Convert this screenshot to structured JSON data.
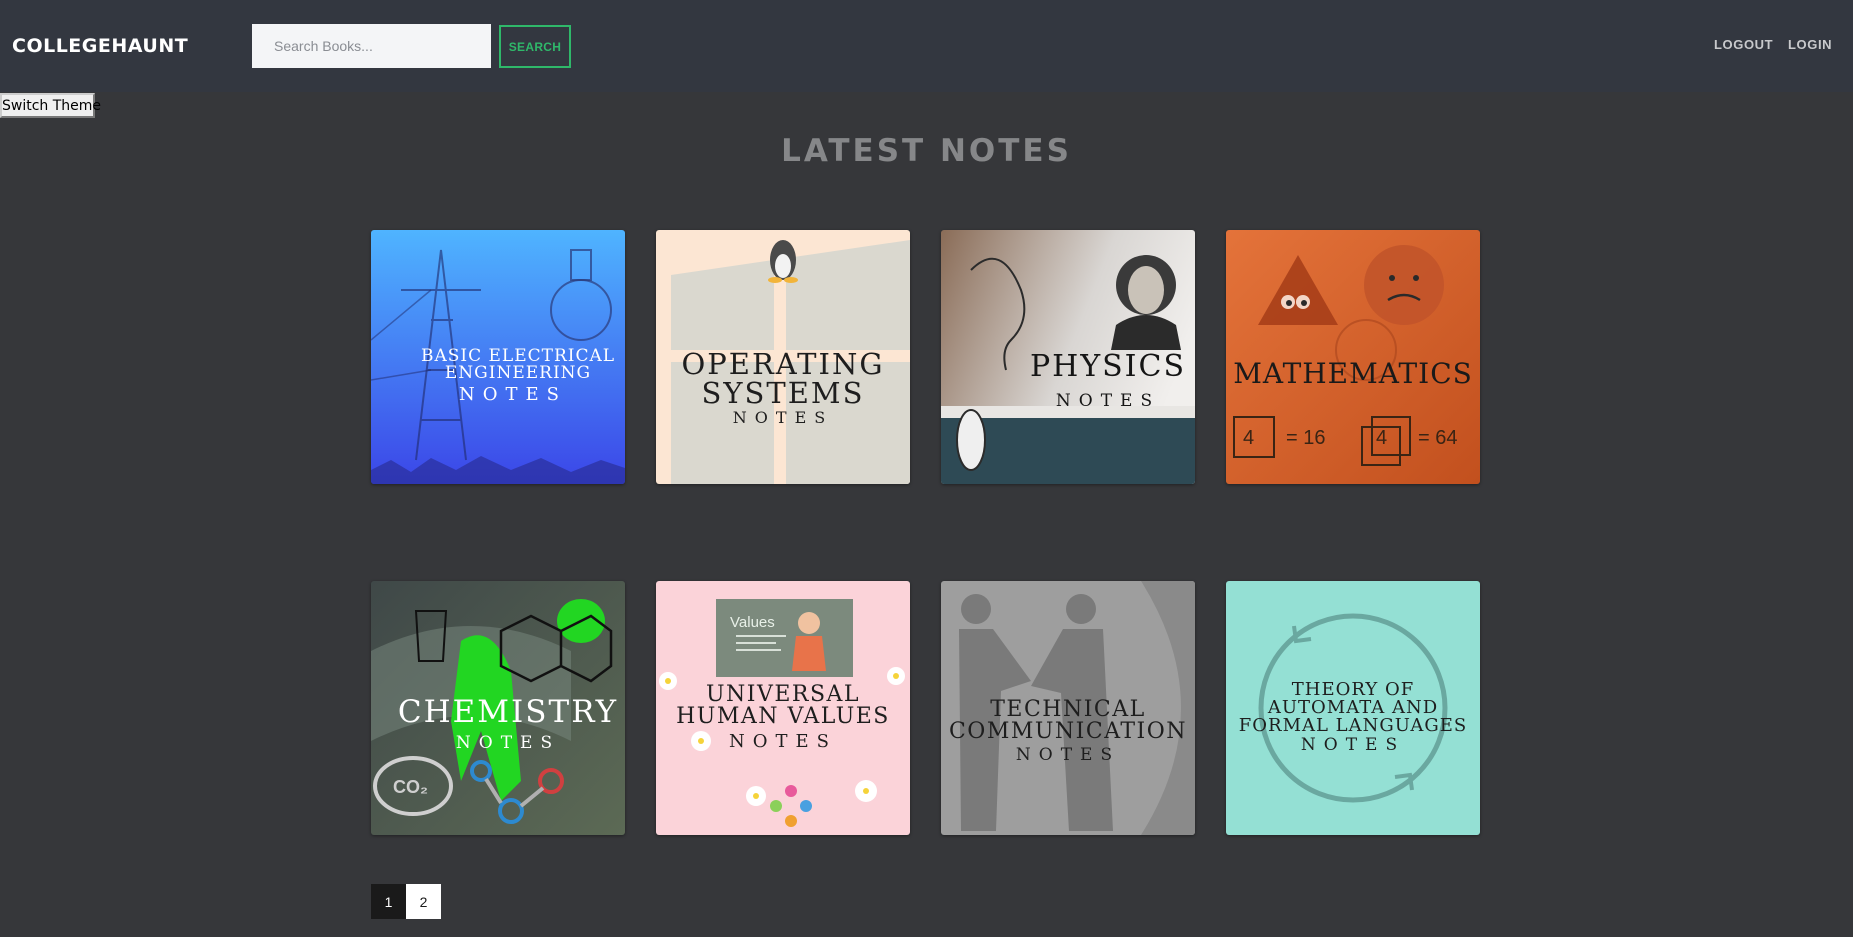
{
  "brand": "COLLEGEHAUNT",
  "search": {
    "placeholder": "Search Books...",
    "value": "",
    "button_label": "SEARCH"
  },
  "nav": {
    "logout_label": "LOGOUT",
    "login_label": "LOGIN"
  },
  "switch_theme_label": "Switch Theme",
  "section_title": "LATEST NOTES",
  "notes": [
    {
      "title": "BASIC ELECTRICAL ENGINEERING",
      "subtitle": "NOTES",
      "colors": [
        "#4fb4ff",
        "#3b46e8"
      ],
      "icon": "lightbulb-icon"
    },
    {
      "title": "OPERATING SYSTEMS",
      "subtitle": "NOTES",
      "colors": [
        "#fce6d3",
        "#dad8cf"
      ],
      "icon": "penguin-icon"
    },
    {
      "title": "PHYSICS",
      "subtitle": "NOTES",
      "colors": [
        "#8a6c57",
        "#2e4a55"
      ],
      "icon": "apple-icon"
    },
    {
      "title": "MATHEMATICS",
      "subtitle": "",
      "colors": [
        "#e4733a",
        "#c2501e"
      ],
      "icon": "triangle-icon",
      "equations": [
        "4",
        "= 16",
        "4",
        "= 64"
      ]
    },
    {
      "title": "CHEMISTRY",
      "subtitle": "NOTES",
      "colors": [
        "#3f4848",
        "#5c6a55"
      ],
      "icon": "molecule-icon",
      "badge": "CO₂"
    },
    {
      "title": "UNIVERSAL HUMAN VALUES",
      "subtitle": "NOTES",
      "colors": [
        "#fbd3d9",
        "#f6bcc6"
      ],
      "icon": "flower-icon",
      "board_text": "Values"
    },
    {
      "title": "TECHNICAL COMMUNICATION",
      "subtitle": "NOTES",
      "colors": [
        "#9e9e9e",
        "#8a8a8a"
      ],
      "icon": "handshake-icon"
    },
    {
      "title": "THEORY OF AUTOMATA AND FORMAL LANGUAGES",
      "subtitle": "NOTES",
      "colors": [
        "#94e0d4",
        "#7dd3c5"
      ],
      "icon": "cycle-icon"
    }
  ],
  "pagination": {
    "pages": [
      "1",
      "2"
    ],
    "current": "1"
  },
  "theme": {
    "background": "#36373a",
    "navbar": "#333740",
    "accent": "#2fb86a"
  }
}
